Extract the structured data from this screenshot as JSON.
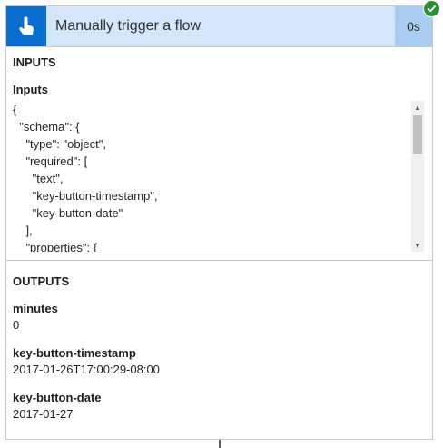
{
  "header": {
    "title": "Manually trigger a flow",
    "duration": "0s",
    "trigger_icon": "touch-hand-icon",
    "status_icon": "check-icon",
    "colors": {
      "icon_bg": "#0a6ed1",
      "header_bg": "#d3e6fb",
      "duration_bg": "#a8cdf1",
      "status_badge": "#2b8f37"
    }
  },
  "inputs": {
    "section_title": "INPUTS",
    "label": "Inputs",
    "code_lines": [
      "{",
      "  \"schema\": {",
      "    \"type\": \"object\",",
      "    \"required\": [",
      "      \"text\",",
      "      \"key-button-timestamp\",",
      "      \"key-button-date\"",
      "    ],",
      "    \"properties\": {"
    ]
  },
  "outputs": {
    "section_title": "OUTPUTS",
    "fields": [
      {
        "label": "minutes",
        "value": "0"
      },
      {
        "label": "key-button-timestamp",
        "value": "2017-01-26T17:00:29-08:00"
      },
      {
        "label": "key-button-date",
        "value": "2017-01-27"
      }
    ]
  }
}
